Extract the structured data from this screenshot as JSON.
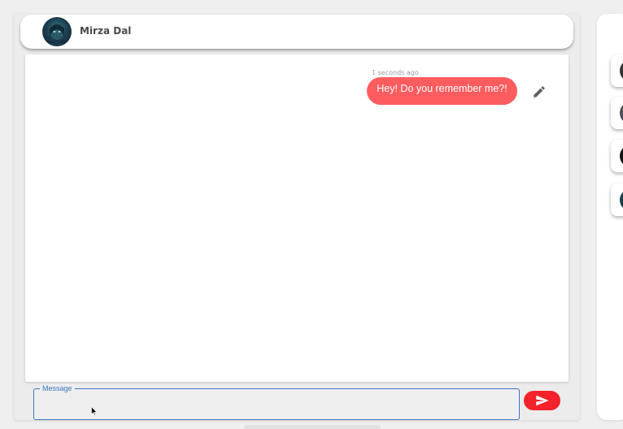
{
  "header": {
    "contact_name": "Mirza Dal"
  },
  "messages": [
    {
      "time": "1 seconds ago",
      "text": "Hey! Do you remember me?!"
    }
  ],
  "composer": {
    "label": "Message",
    "value": "",
    "placeholder": ""
  },
  "colors": {
    "bubble": "#ff5c5f",
    "send_button": "#f4222a",
    "input_focus": "#3a76c4"
  },
  "icons": {
    "edit": "pencil-icon",
    "send": "send-icon"
  }
}
